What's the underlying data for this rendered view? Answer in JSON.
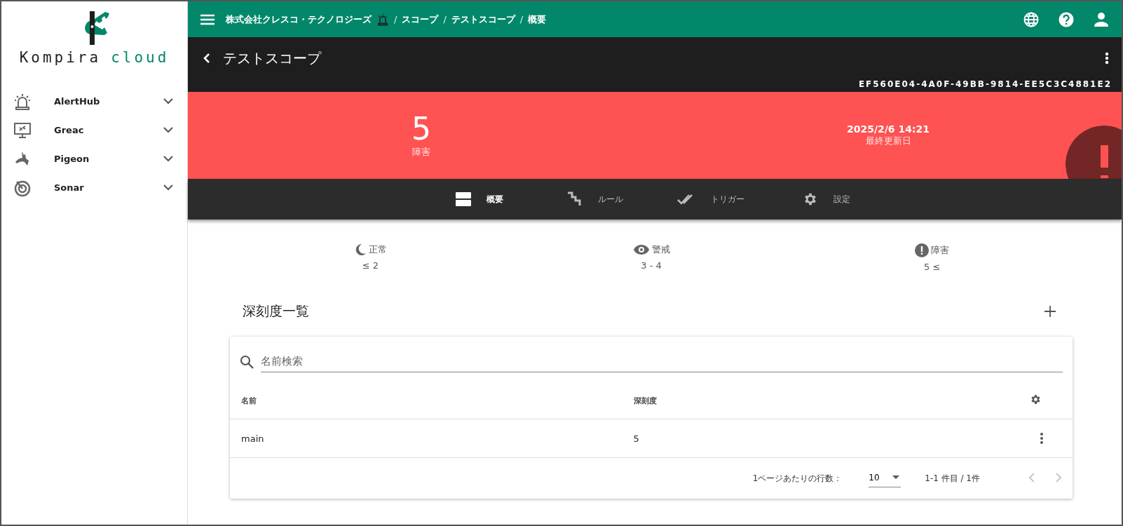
{
  "sidebar": {
    "logo": {
      "word_1": "Kompira",
      "word_2": "cloud"
    },
    "items": [
      {
        "kind": "alert",
        "label": "AlertHub",
        "expanded": false
      },
      {
        "kind": "monitor",
        "label": "Greac",
        "expanded": false
      },
      {
        "kind": "pigeon",
        "label": "Pigeon",
        "expanded": false
      },
      {
        "kind": "sonar",
        "label": "Sonar",
        "expanded": false
      }
    ]
  },
  "header": {
    "breadcrumbs": [
      "株式会社クレスコ・テクノロジーズ",
      "スコープ",
      "テストスコープ",
      "概要"
    ],
    "separator": "/"
  },
  "scope": {
    "title": "テストスコープ",
    "id": "EF560E04-4A0F-49BB-9814-EE5C3C4881E2"
  },
  "status": {
    "kind": "error",
    "count": "5",
    "count_label": "障害",
    "updated": "2025/2/6 14:21",
    "updated_label": "最終更新日"
  },
  "tabs": [
    {
      "kind": "overview",
      "label": "概要",
      "selected": true
    },
    {
      "kind": "rule",
      "label": "ルール",
      "selected": false
    },
    {
      "kind": "trigger",
      "label": "トリガー",
      "selected": false
    },
    {
      "kind": "settings",
      "label": "設定",
      "selected": false
    }
  ],
  "thresholds": [
    {
      "kind": "normal",
      "label": "正常",
      "range": "≤ 2"
    },
    {
      "kind": "warning",
      "label": "警戒",
      "range": "3 - 4"
    },
    {
      "kind": "error",
      "label": "障害",
      "range": "5 ≤"
    }
  ],
  "severity_list": {
    "title": "深刻度一覧",
    "search": {
      "placeholder": "名前検索"
    },
    "columns": [
      "名前",
      "深刻度"
    ],
    "rows": [
      [
        "main",
        "5"
      ]
    ],
    "pagination": {
      "rows_per_page_label": "1ページあたりの行数：",
      "rows_per_page": "10",
      "range": "1-1 件目 / 1件"
    }
  }
}
